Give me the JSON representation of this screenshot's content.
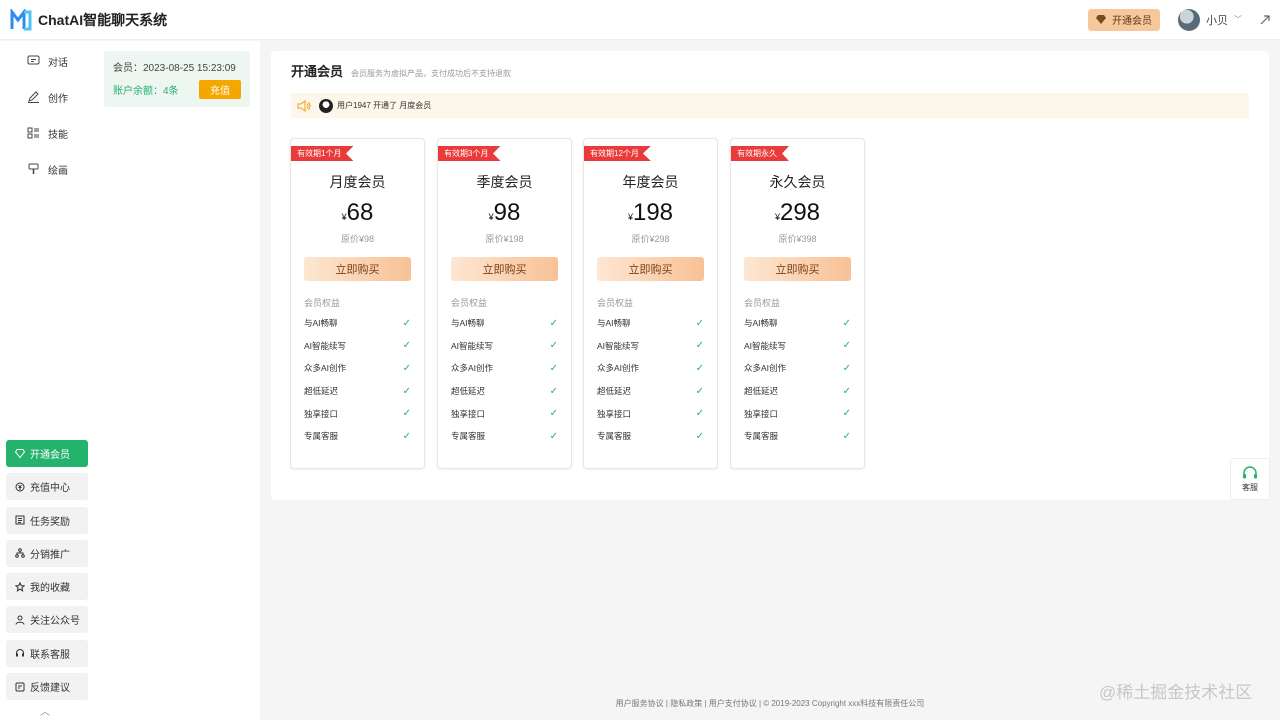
{
  "header": {
    "app_title": "ChatAI智能聊天系统",
    "vip_label": "开通会员",
    "user_name": "小贝"
  },
  "nav": {
    "items": [
      {
        "label": "对话",
        "icon": "chat-icon"
      },
      {
        "label": "创作",
        "icon": "pen-icon"
      },
      {
        "label": "技能",
        "icon": "skills-icon"
      },
      {
        "label": "绘画",
        "icon": "brush-icon"
      }
    ],
    "bottom": [
      {
        "label": "开通会员",
        "icon": "diamond-icon",
        "active": true
      },
      {
        "label": "充值中心",
        "icon": "recharge-icon"
      },
      {
        "label": "任务奖励",
        "icon": "task-icon"
      },
      {
        "label": "分销推广",
        "icon": "share-tree-icon"
      },
      {
        "label": "我的收藏",
        "icon": "star-icon"
      },
      {
        "label": "关注公众号",
        "icon": "user-icon"
      },
      {
        "label": "联系客服",
        "icon": "headset-icon"
      },
      {
        "label": "反馈建议",
        "icon": "feedback-icon"
      }
    ]
  },
  "member": {
    "expiry": "会员：2023-08-25 15:23:09",
    "balance": "账户余额：4条",
    "recharge_label": "充值"
  },
  "main": {
    "title": "开通会员",
    "subtitle": "会员服务为虚拟产品，支付成功后不支持退款",
    "notice": "用户1947 开通了 月度会员"
  },
  "plans": [
    {
      "ribbon": "有效期1个月",
      "name": "月度会员",
      "price": "68",
      "original": "原价¥98"
    },
    {
      "ribbon": "有效期3个月",
      "name": "季度会员",
      "price": "98",
      "original": "原价¥198"
    },
    {
      "ribbon": "有效期12个月",
      "name": "年度会员",
      "price": "198",
      "original": "原价¥298"
    },
    {
      "ribbon": "有效期永久",
      "name": "永久会员",
      "price": "298",
      "original": "原价¥398"
    }
  ],
  "plan_labels": {
    "currency": "¥",
    "buy": "立即购买",
    "benefits_title": "会员权益",
    "benefits": [
      "与AI畅聊",
      "AI智能续写",
      "众多AI创作",
      "超低延迟",
      "独享接口",
      "专属客服"
    ]
  },
  "service_label": "客服",
  "footer": "用户服务协议 | 隐私政策 | 用户支付协议 | © 2019-2023 Copyright xxx科技有限责任公司",
  "watermark": "@稀土掘金技术社区",
  "colors": {
    "accent": "#24b26c",
    "ribbon": "#ea3a3a",
    "recharge": "#f5a700"
  }
}
